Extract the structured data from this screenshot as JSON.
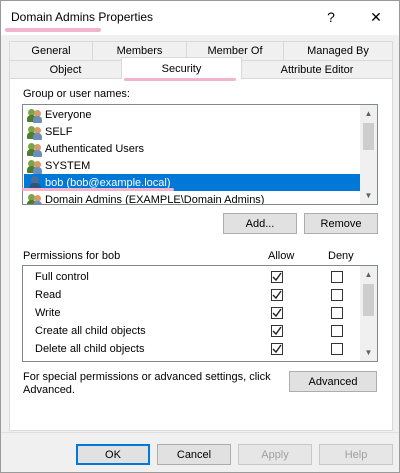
{
  "window": {
    "title": "Domain Admins Properties",
    "help_glyph": "?",
    "close_glyph": "✕"
  },
  "tabs": {
    "row1": [
      "General",
      "Members",
      "Member Of",
      "Managed By"
    ],
    "row2": [
      "Object",
      "Security",
      "Attribute Editor"
    ],
    "active": "Security"
  },
  "users_section": {
    "label": "Group or user names:",
    "items": [
      {
        "name": "Everyone",
        "icon": "group-icon"
      },
      {
        "name": "SELF",
        "icon": "group-icon"
      },
      {
        "name": "Authenticated Users",
        "icon": "group-icon"
      },
      {
        "name": "SYSTEM",
        "icon": "group-icon"
      },
      {
        "name": "bob (bob@example.local)",
        "icon": "user-icon",
        "selected": true
      },
      {
        "name": "Domain Admins (EXAMPLE\\Domain Admins)",
        "icon": "group-icon"
      }
    ],
    "add_label": "Add...",
    "remove_label": "Remove"
  },
  "permissions_section": {
    "label": "Permissions for bob",
    "allow_header": "Allow",
    "deny_header": "Deny",
    "rows": [
      {
        "name": "Full control",
        "allow": true,
        "deny": false
      },
      {
        "name": "Read",
        "allow": true,
        "deny": false
      },
      {
        "name": "Write",
        "allow": true,
        "deny": false
      },
      {
        "name": "Create all child objects",
        "allow": true,
        "deny": false
      },
      {
        "name": "Delete all child objects",
        "allow": true,
        "deny": false
      }
    ]
  },
  "advanced_section": {
    "text_line1": "For special permissions or advanced settings, click",
    "text_line2": "Advanced.",
    "advanced_label": "Advanced"
  },
  "footer": {
    "ok_label": "OK",
    "cancel_label": "Cancel",
    "apply_label": "Apply",
    "help_label": "Help"
  },
  "colors": {
    "selection": "#0078d7",
    "highlight_marker": "#f2b3cd"
  }
}
